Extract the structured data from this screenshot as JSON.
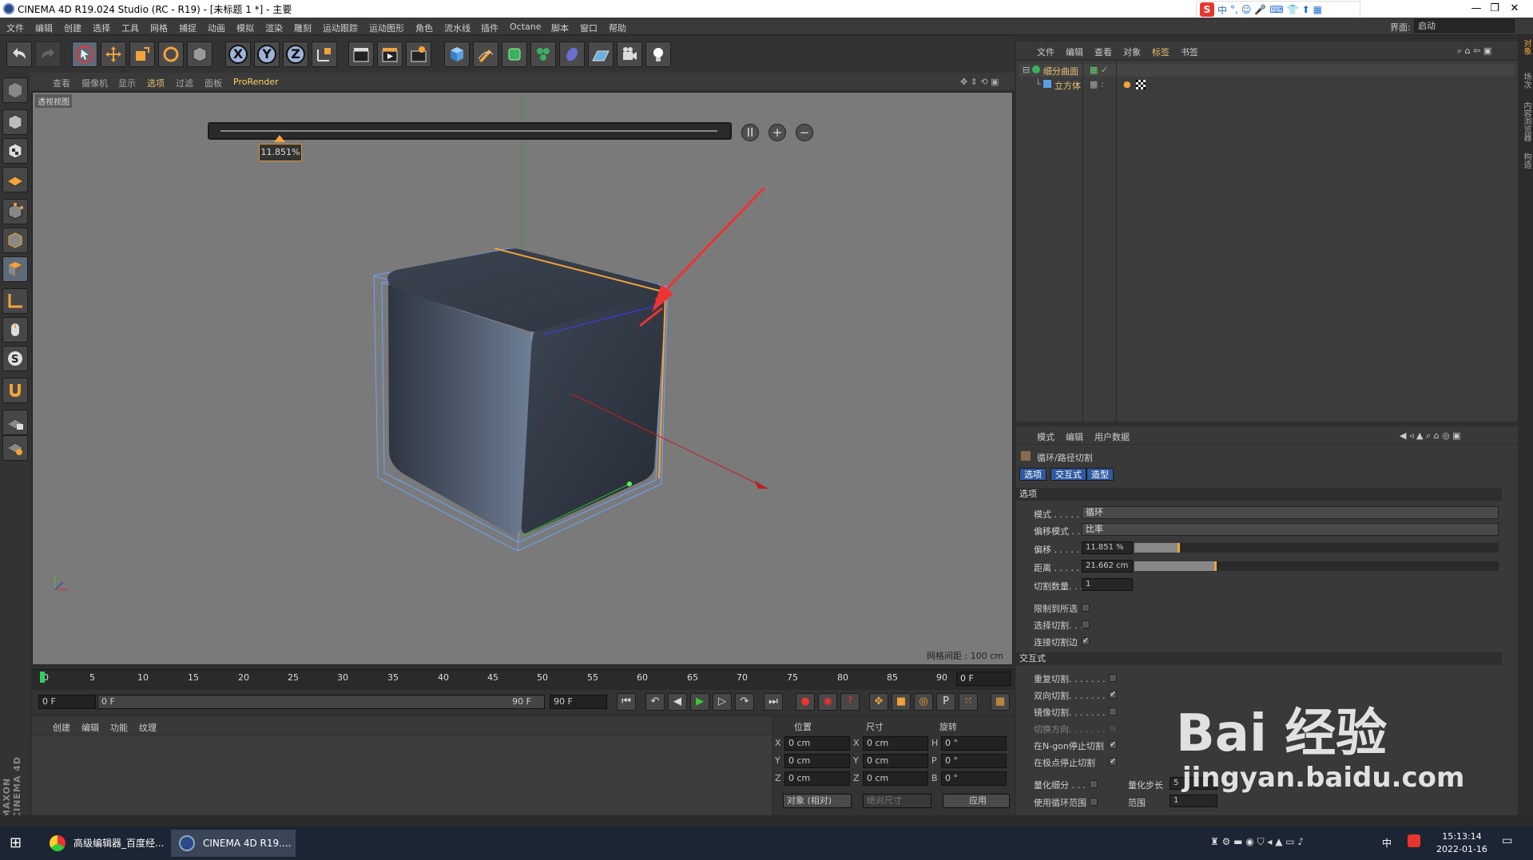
{
  "window": {
    "title": "CINEMA 4D R19.024 Studio (RC - R19) - [未标题 1 *] - 主要",
    "min": "—",
    "max": "❐",
    "close": "✕"
  },
  "ime": {
    "logo": "S",
    "items": [
      "中",
      "°,",
      "☺",
      "🎤",
      "⌨",
      "👕",
      "⬆",
      "▦"
    ]
  },
  "menu": [
    "文件",
    "编辑",
    "创建",
    "选择",
    "工具",
    "网格",
    "捕捉",
    "动画",
    "模拟",
    "渲染",
    "雕刻",
    "运动跟踪",
    "运动图形",
    "角色",
    "流水线",
    "插件",
    "Octane",
    "脚本",
    "窗口",
    "帮助"
  ],
  "layout": {
    "label": "界面:",
    "value": "启动"
  },
  "toolbar": {
    "x": "X",
    "y": "Y",
    "z": "Z"
  },
  "viewport": {
    "menu": [
      "查看",
      "摄像机",
      "显示",
      "选项",
      "过滤",
      "面板",
      "ProRender"
    ],
    "label": "透视视图",
    "slider_value": "11.851%",
    "slider_fraction": 0.11851,
    "grid_info": "网格间距 : 100 cm",
    "btn_pause": "II",
    "btn_plus": "+",
    "btn_minus": "−"
  },
  "timeline": {
    "ticks": [
      "0",
      "5",
      "10",
      "15",
      "20",
      "25",
      "30",
      "35",
      "40",
      "45",
      "50",
      "55",
      "60",
      "65",
      "70",
      "75",
      "80",
      "85",
      "90"
    ],
    "frame_end": "0 F"
  },
  "transport": {
    "start": "0 F",
    "range_start": "0 F",
    "range_end": "90 F",
    "end": "90 F"
  },
  "materials": {
    "menu": [
      "创建",
      "编辑",
      "功能",
      "纹理"
    ],
    "brand": "MAXON CINEMA 4D"
  },
  "coords": {
    "headers": [
      "位置",
      "尺寸",
      "旋转"
    ],
    "rows": [
      {
        "axis": "X",
        "pos": "0 cm",
        "saxis": "X",
        "size": "0 cm",
        "raxis": "H",
        "rot": "0 °"
      },
      {
        "axis": "Y",
        "pos": "0 cm",
        "saxis": "Y",
        "size": "0 cm",
        "raxis": "P",
        "rot": "0 °"
      },
      {
        "axis": "Z",
        "pos": "0 cm",
        "saxis": "Z",
        "size": "0 cm",
        "raxis": "B",
        "rot": "0 °"
      }
    ],
    "mode": "对象 (相对)",
    "size_mode": "绝对尺寸",
    "apply": "应用"
  },
  "objects": {
    "menu": [
      "文件",
      "编辑",
      "查看",
      "对象",
      "标签",
      "书签"
    ],
    "items": [
      {
        "name": "细分曲面"
      },
      {
        "name": "立方体"
      }
    ]
  },
  "attributes": {
    "menu": [
      "模式",
      "编辑",
      "用户数据"
    ],
    "tool_name": "循环/路径切割",
    "tabs": [
      "选项",
      "交互式",
      "造型"
    ],
    "section_options": "选项",
    "mode_label": "模式 . . . . .",
    "mode_value": "循环",
    "offset_mode_label": "偏移模式 . . .",
    "offset_mode_value": "比率",
    "offset_label": "偏移 . . . . .",
    "offset_value": "11.851 %",
    "offset_fraction": 0.11851,
    "distance_label": "距离 . . . . .",
    "distance_value": "21.662 cm",
    "distance_fraction": 0.22,
    "cuts_label": "切割数量. . . .",
    "cuts_value": "1",
    "limit_label": "限制到所选",
    "select_label": "选择切割. . .",
    "connect_label": "连接切割边",
    "section_interactive": "交互式",
    "interactive": [
      {
        "label": "重复切割. . . . . . . . .",
        "checked": false
      },
      {
        "label": "双向切割. . . . . . . . .",
        "checked": true
      },
      {
        "label": "镜像切割. . . . . . . . .",
        "checked": false
      },
      {
        "label": "切换方向. . . . . . . . .",
        "checked": false
      },
      {
        "label": "在N-gon停止切割",
        "checked": true
      },
      {
        "label": "在极点停止切割",
        "checked": true
      }
    ],
    "quant_label": "量化细分 . . .",
    "quant_step_label": "量化步长",
    "quant_step_value": "5",
    "use_loop_label": "使用循环范围",
    "range_label": "范围",
    "range_value": "1",
    "section_shape": "造型"
  },
  "right_strip": [
    "对象",
    "场次",
    "内容浏览器",
    "构造"
  ],
  "taskbar": {
    "tasks": [
      "高级编辑器_百度经...",
      "CINEMA 4D R19...."
    ],
    "time": "15:13:14",
    "date": "2022-01-16",
    "lang": "中"
  },
  "watermark": {
    "text": "Bai 经验",
    "url": "jingyan.baidu.com"
  },
  "colors": {
    "accent": "#f3a33a",
    "selected_tab": "#2f5aa0",
    "viewport_bg": "#7a7a7a"
  }
}
